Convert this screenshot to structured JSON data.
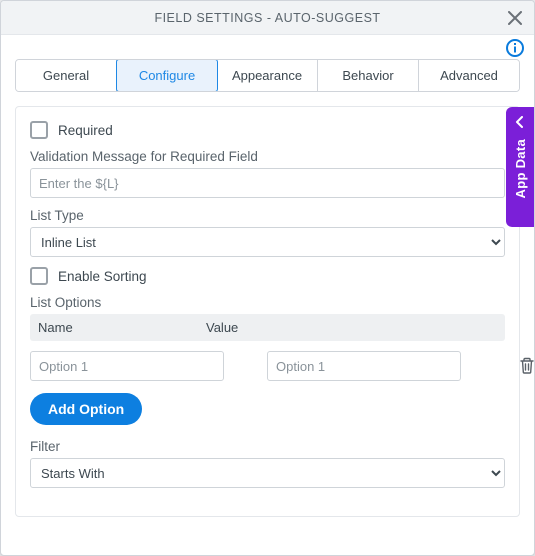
{
  "title": "FIELD SETTINGS - AUTO-SUGGEST",
  "tabs": {
    "general": "General",
    "configure": "Configure",
    "appearance": "Appearance",
    "behavior": "Behavior",
    "advanced": "Advanced"
  },
  "form": {
    "required_label": "Required",
    "validation_label": "Validation Message for Required Field",
    "validation_placeholder": "Enter the ${L}",
    "list_type_label": "List Type",
    "list_type_value": "Inline List",
    "enable_sorting_label": "Enable Sorting",
    "list_options_label": "List Options",
    "columns": {
      "name": "Name",
      "value": "Value"
    },
    "options": [
      {
        "name_placeholder": "Option 1",
        "value_placeholder": "Option 1"
      }
    ],
    "add_option_label": "Add Option",
    "filter_label": "Filter",
    "filter_value": "Starts With"
  },
  "side_panel": {
    "label": "App Data"
  }
}
